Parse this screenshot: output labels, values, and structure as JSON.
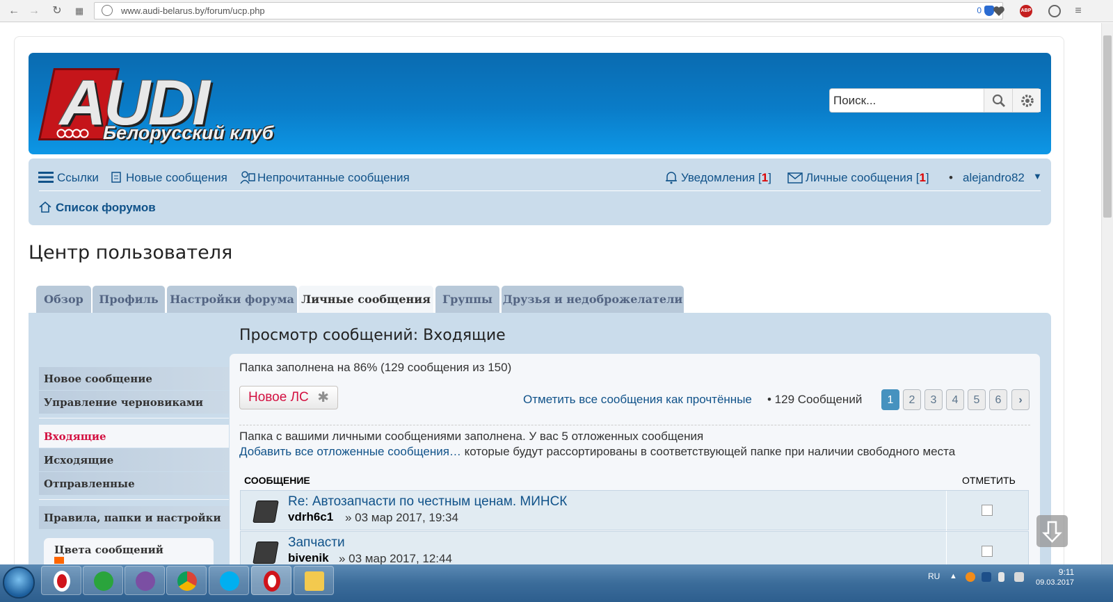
{
  "browser": {
    "url": "www.audi-belarus.by/forum/ucp.php",
    "adblock_count": "0",
    "abp_label": "ABP"
  },
  "header": {
    "logo_text": "AUDI",
    "logo_subtitle": "Белорусский клуб",
    "search_placeholder": "Поиск..."
  },
  "navbar": {
    "links_label": "Ссылки",
    "new_posts_label": "Новые сообщения",
    "unread_posts_label": "Непрочитанные сообщения",
    "notifications_label": "Уведомления",
    "notifications_count": "1",
    "pm_label": "Личные сообщения",
    "pm_count": "1",
    "username": "alejandro82",
    "breadcrumb": "Список форумов"
  },
  "page_title": "Центр пользователя",
  "tabs": [
    {
      "label": "Обзор"
    },
    {
      "label": "Профиль"
    },
    {
      "label": "Настройки форума"
    },
    {
      "label": "Личные сообщения"
    },
    {
      "label": "Группы"
    },
    {
      "label": "Друзья и недоброжелатели"
    }
  ],
  "sidebar": {
    "items": [
      {
        "label": "Новое сообщение"
      },
      {
        "label": "Управление черновиками"
      },
      {
        "label": "Входящие"
      },
      {
        "label": "Исходящие"
      },
      {
        "label": "Отправленные"
      },
      {
        "label": "Правила, папки и настройки"
      }
    ],
    "colors_title": "Цвета сообщений"
  },
  "content": {
    "title": "Просмотр сообщений: Входящие",
    "folder_status": "Папка заполнена на 86% (129 сообщения из 150)",
    "new_pm_button": "Новое ЛС",
    "mark_all_read": "Отметить все сообщения как прочтённые",
    "message_count": "• 129 Сообщений",
    "pages": [
      "1",
      "2",
      "3",
      "4",
      "5",
      "6"
    ],
    "notice_line1": "Папка с вашими личными сообщениями заполнена. У вас 5 отложенных сообщения",
    "notice_link": "Добавить все отложенные сообщения…",
    "notice_line2_rest": " которые будут рассортированы в соответствующей папке при наличии свободного места",
    "col_message": "Сообщение",
    "col_mark": "Отметить",
    "messages": [
      {
        "title": "Re: Автозапчасти по честным ценам. МИНСК",
        "author": "vdrh6c1",
        "date": "» 03 мар 2017, 19:34"
      },
      {
        "title": "Запчасти",
        "author": "bivenik",
        "date": "» 03 мар 2017, 12:44"
      }
    ]
  },
  "taskbar": {
    "lang": "RU",
    "time": "9:11",
    "date": "09.03.2017"
  }
}
